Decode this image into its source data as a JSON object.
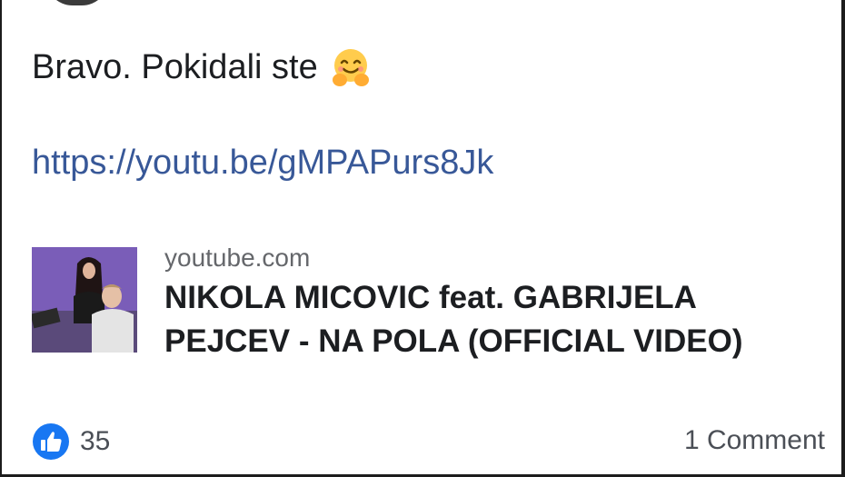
{
  "post": {
    "text": "Bravo. Pokidali ste",
    "emoji": "hugging-face-icon",
    "link_url": "https://youtu.be/gMPAPurs8Jk"
  },
  "preview": {
    "domain": "youtube.com",
    "title": "NIKOLA MICOVIC feat. GABRIJELA PEJCEV - NA POLA (OFFICIAL VIDEO)",
    "thumbnail": "video-thumbnail"
  },
  "footer": {
    "like_icon": "thumbs-up-icon",
    "like_count": "35",
    "comments_label": "1 Comment"
  },
  "colors": {
    "link": "#385898",
    "like_blue": "#1877f2",
    "text": "#1c1e21",
    "muted": "#65676b"
  }
}
